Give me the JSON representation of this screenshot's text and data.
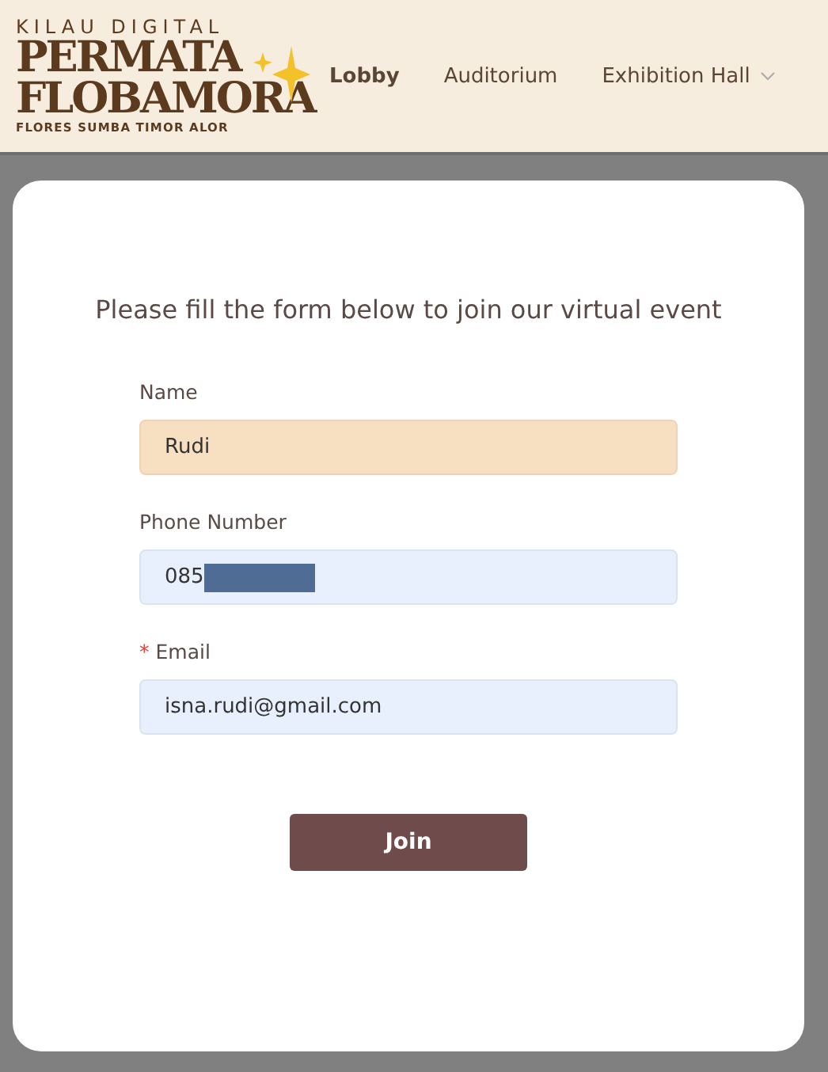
{
  "logo": {
    "tagline": "KILAU DIGITAL",
    "line_1": "PERMATA",
    "line_2": "FLOBAMORA",
    "subtitle": "FLORES SUMBA TIMOR ALOR"
  },
  "nav": [
    {
      "label": "Lobby",
      "selected": true,
      "has_menu": false
    },
    {
      "label": "Auditorium",
      "selected": false,
      "has_menu": false
    },
    {
      "label": "Exhibition Hall",
      "selected": false,
      "has_menu": true
    }
  ],
  "form": {
    "title": "Please fill the form below to join our virtual event",
    "fields": [
      {
        "label": "Name",
        "value": "Rudi",
        "highlighted": true,
        "redacted": false
      },
      {
        "label": "Phone Number",
        "value": "085",
        "highlighted": false,
        "redacted": true
      },
      {
        "required_mark": "*",
        "label": "Email",
        "value": "isna.rudi@gmail.com",
        "highlighted": false,
        "redacted": false
      }
    ],
    "submit": "Join"
  }
}
